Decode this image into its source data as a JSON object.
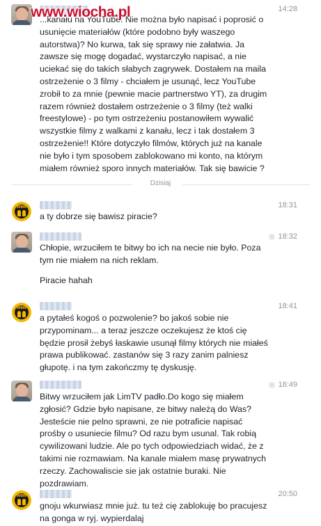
{
  "watermark": "www.wiocha.pl",
  "divider_label": "Dzisiaj",
  "messages": [
    {
      "avatar": "person-photo-avatar",
      "time": "14:28",
      "paragraphs": [
        "...kanału na YouTube. Nie można było napisać i poprosić o usunięcie materiałów (które podobno były waszego autorstwa)? No kurwa, tak się sprawy nie załatwia. Ja zawsze się mogę dogadać, wystarczyło napisać, a nie uciekać się do takich słabych zagrywek. Dostałem na maila ostrzeżenie o 3 filmy - chciałem je usunąć, lecz YouTube zrobił to za mnie (pewnie macie partnerstwo YT), za drugim razem również dostałem ostrzeżenie o 3 filmy (też walki freestylowe) - po tym ostrzeżeniu postanowiłem wywalić wszystkie filmy z walkami z kanału, lecz i tak dostałem 3 ostrzeżenie!! Które dotyczyło filmów, których już na kanale nie było i tym sposobem zablokowano mi konto, na którym miałem również sporo innych materiałów.  Tak się bawicie ?"
      ]
    },
    {
      "avatar": "wbw-logo-avatar",
      "time": "18:31",
      "paragraphs": [
        "a ty dobrze się bawisz piracie?"
      ]
    },
    {
      "avatar": "person-photo-avatar",
      "time": "18:32",
      "paragraphs": [
        "Chłopie, wrzuciłem te bitwy bo ich na necie nie było. Poza tym nie miałem na nich reklam.",
        "Piracie hahah"
      ]
    },
    {
      "avatar": "wbw-logo-avatar",
      "time": "18:41",
      "paragraphs": [
        "a pytałeś kogoś o pozwolenie? bo jakoś sobie nie przypominam... a teraz jeszcze oczekujesz że ktoś cię będzie prosił żebyś łaskawie usunął filmy których nie miałeś prawa publikować. zastanów się 3 razy zanim palniesz głupotę. i na tym zakończmy tę dyskusję."
      ]
    },
    {
      "avatar": "person-photo-avatar",
      "time": "18:49",
      "paragraphs": [
        "Bitwy wrzuciłem jak LimTV padło.Do kogo się miałem zgłosić? Gdzie było napisane, ze bitwy należą do Was? Jesteście nie pelno sprawni, ze nie potraficie napisać prośby o usuniecie filmu? Od razu bym usunal. Tak robią cywilizowani ludzie. Ale po tych odpowiedziach widać, że z takimi nie rozmawiam. Na kanale miałem masę prywatnych rzeczy. Zachowaliscie sie jak ostatnie buraki. Nie pozdrawiam."
      ]
    },
    {
      "avatar": "wbw-logo-avatar",
      "time": "20:50",
      "paragraphs": [
        "gnoju wkurwiasz mnie już. tu też cię zablokuję bo pracujesz na gonga w ryj. wypierdalaj"
      ]
    }
  ]
}
